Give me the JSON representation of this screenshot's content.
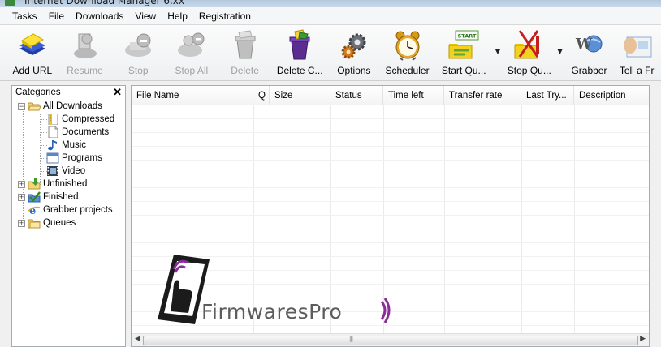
{
  "window": {
    "title": "Internet Download Manager 6.xx"
  },
  "menu": [
    "Tasks",
    "File",
    "Downloads",
    "View",
    "Help",
    "Registration"
  ],
  "toolbar": [
    {
      "label": "Add URL",
      "icon": "add-url-icon",
      "enabled": true
    },
    {
      "label": "Resume",
      "icon": "resume-icon",
      "enabled": false
    },
    {
      "label": "Stop",
      "icon": "stop-icon",
      "enabled": false
    },
    {
      "label": "Stop All",
      "icon": "stop-all-icon",
      "enabled": false
    },
    {
      "label": "Delete",
      "icon": "delete-icon",
      "enabled": false
    },
    {
      "label": "Delete C...",
      "icon": "delete-completed-icon",
      "enabled": true
    },
    {
      "label": "Options",
      "icon": "options-icon",
      "enabled": true
    },
    {
      "label": "Scheduler",
      "icon": "scheduler-icon",
      "enabled": true
    },
    {
      "label": "Start Qu...",
      "icon": "start-queue-icon",
      "enabled": true,
      "dropdown": true
    },
    {
      "label": "Stop Qu...",
      "icon": "stop-queue-icon",
      "enabled": true,
      "dropdown": true
    },
    {
      "label": "Grabber",
      "icon": "grabber-icon",
      "enabled": true
    },
    {
      "label": "Tell a Fr",
      "icon": "tell-a-friend-icon",
      "enabled": true
    }
  ],
  "start_badge": "START",
  "categories": {
    "title": "Categories",
    "close": "✕",
    "items": [
      {
        "label": "All Downloads",
        "icon": "open-folder-icon"
      },
      {
        "label": "Compressed",
        "icon": "compressed-icon"
      },
      {
        "label": "Documents",
        "icon": "document-icon"
      },
      {
        "label": "Music",
        "icon": "music-icon"
      },
      {
        "label": "Programs",
        "icon": "program-icon"
      },
      {
        "label": "Video",
        "icon": "video-icon"
      },
      {
        "label": "Unfinished",
        "icon": "unfinished-icon"
      },
      {
        "label": "Finished",
        "icon": "finished-icon"
      },
      {
        "label": "Grabber projects",
        "icon": "ie-icon"
      },
      {
        "label": "Queues",
        "icon": "queues-folder-icon"
      }
    ]
  },
  "columns": [
    "File Name",
    "Q",
    "Size",
    "Status",
    "Time left",
    "Transfer rate",
    "Last Try...",
    "Description"
  ],
  "watermark": "FirmwaresPro"
}
